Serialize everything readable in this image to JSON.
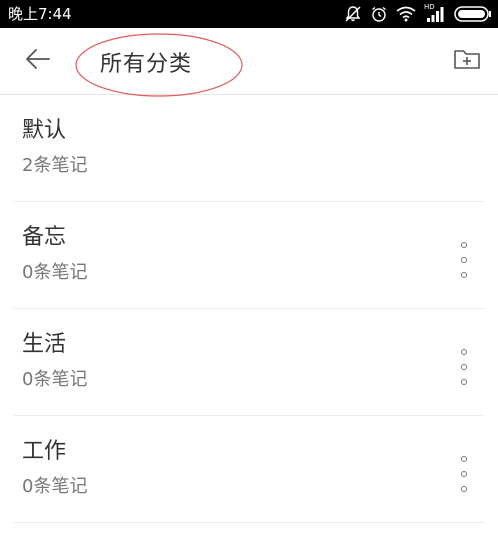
{
  "status_bar": {
    "time": "晚上7:44",
    "network_label": "HD",
    "icons": [
      "mute-icon",
      "alarm-icon",
      "wifi-icon",
      "signal-icon",
      "battery-icon"
    ]
  },
  "header": {
    "title": "所有分类",
    "back_icon": "arrow-left-icon",
    "action_icon": "add-folder-icon",
    "annotation_color": "#e05a5a"
  },
  "categories": [
    {
      "name": "默认",
      "count": "2条笔记",
      "has_menu": false
    },
    {
      "name": "备忘",
      "count": "0条笔记",
      "has_menu": true
    },
    {
      "name": "生活",
      "count": "0条笔记",
      "has_menu": true
    },
    {
      "name": "工作",
      "count": "0条笔记",
      "has_menu": true
    }
  ],
  "colors": {
    "text_primary": "#333333",
    "text_secondary": "#777777",
    "divider": "#ececec"
  }
}
